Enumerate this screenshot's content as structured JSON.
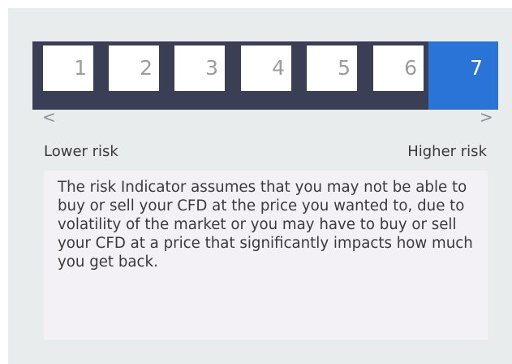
{
  "risk_scale": {
    "levels": [
      "1",
      "2",
      "3",
      "4",
      "5",
      "6",
      "7"
    ],
    "selected_level": 7,
    "selected_color": "#2a74d8",
    "bar_color": "#3a3f55",
    "left_arrow": "<",
    "right_arrow": ">",
    "lower_label": "Lower risk",
    "higher_label": "Higher risk"
  },
  "description": {
    "text": "The risk Indicator assumes that you may not be able to buy or sell your CFD at the price you wanted to, due to volatility of the market or you may have to buy or sell your CFD at a price that significantly impacts how much you get back."
  }
}
